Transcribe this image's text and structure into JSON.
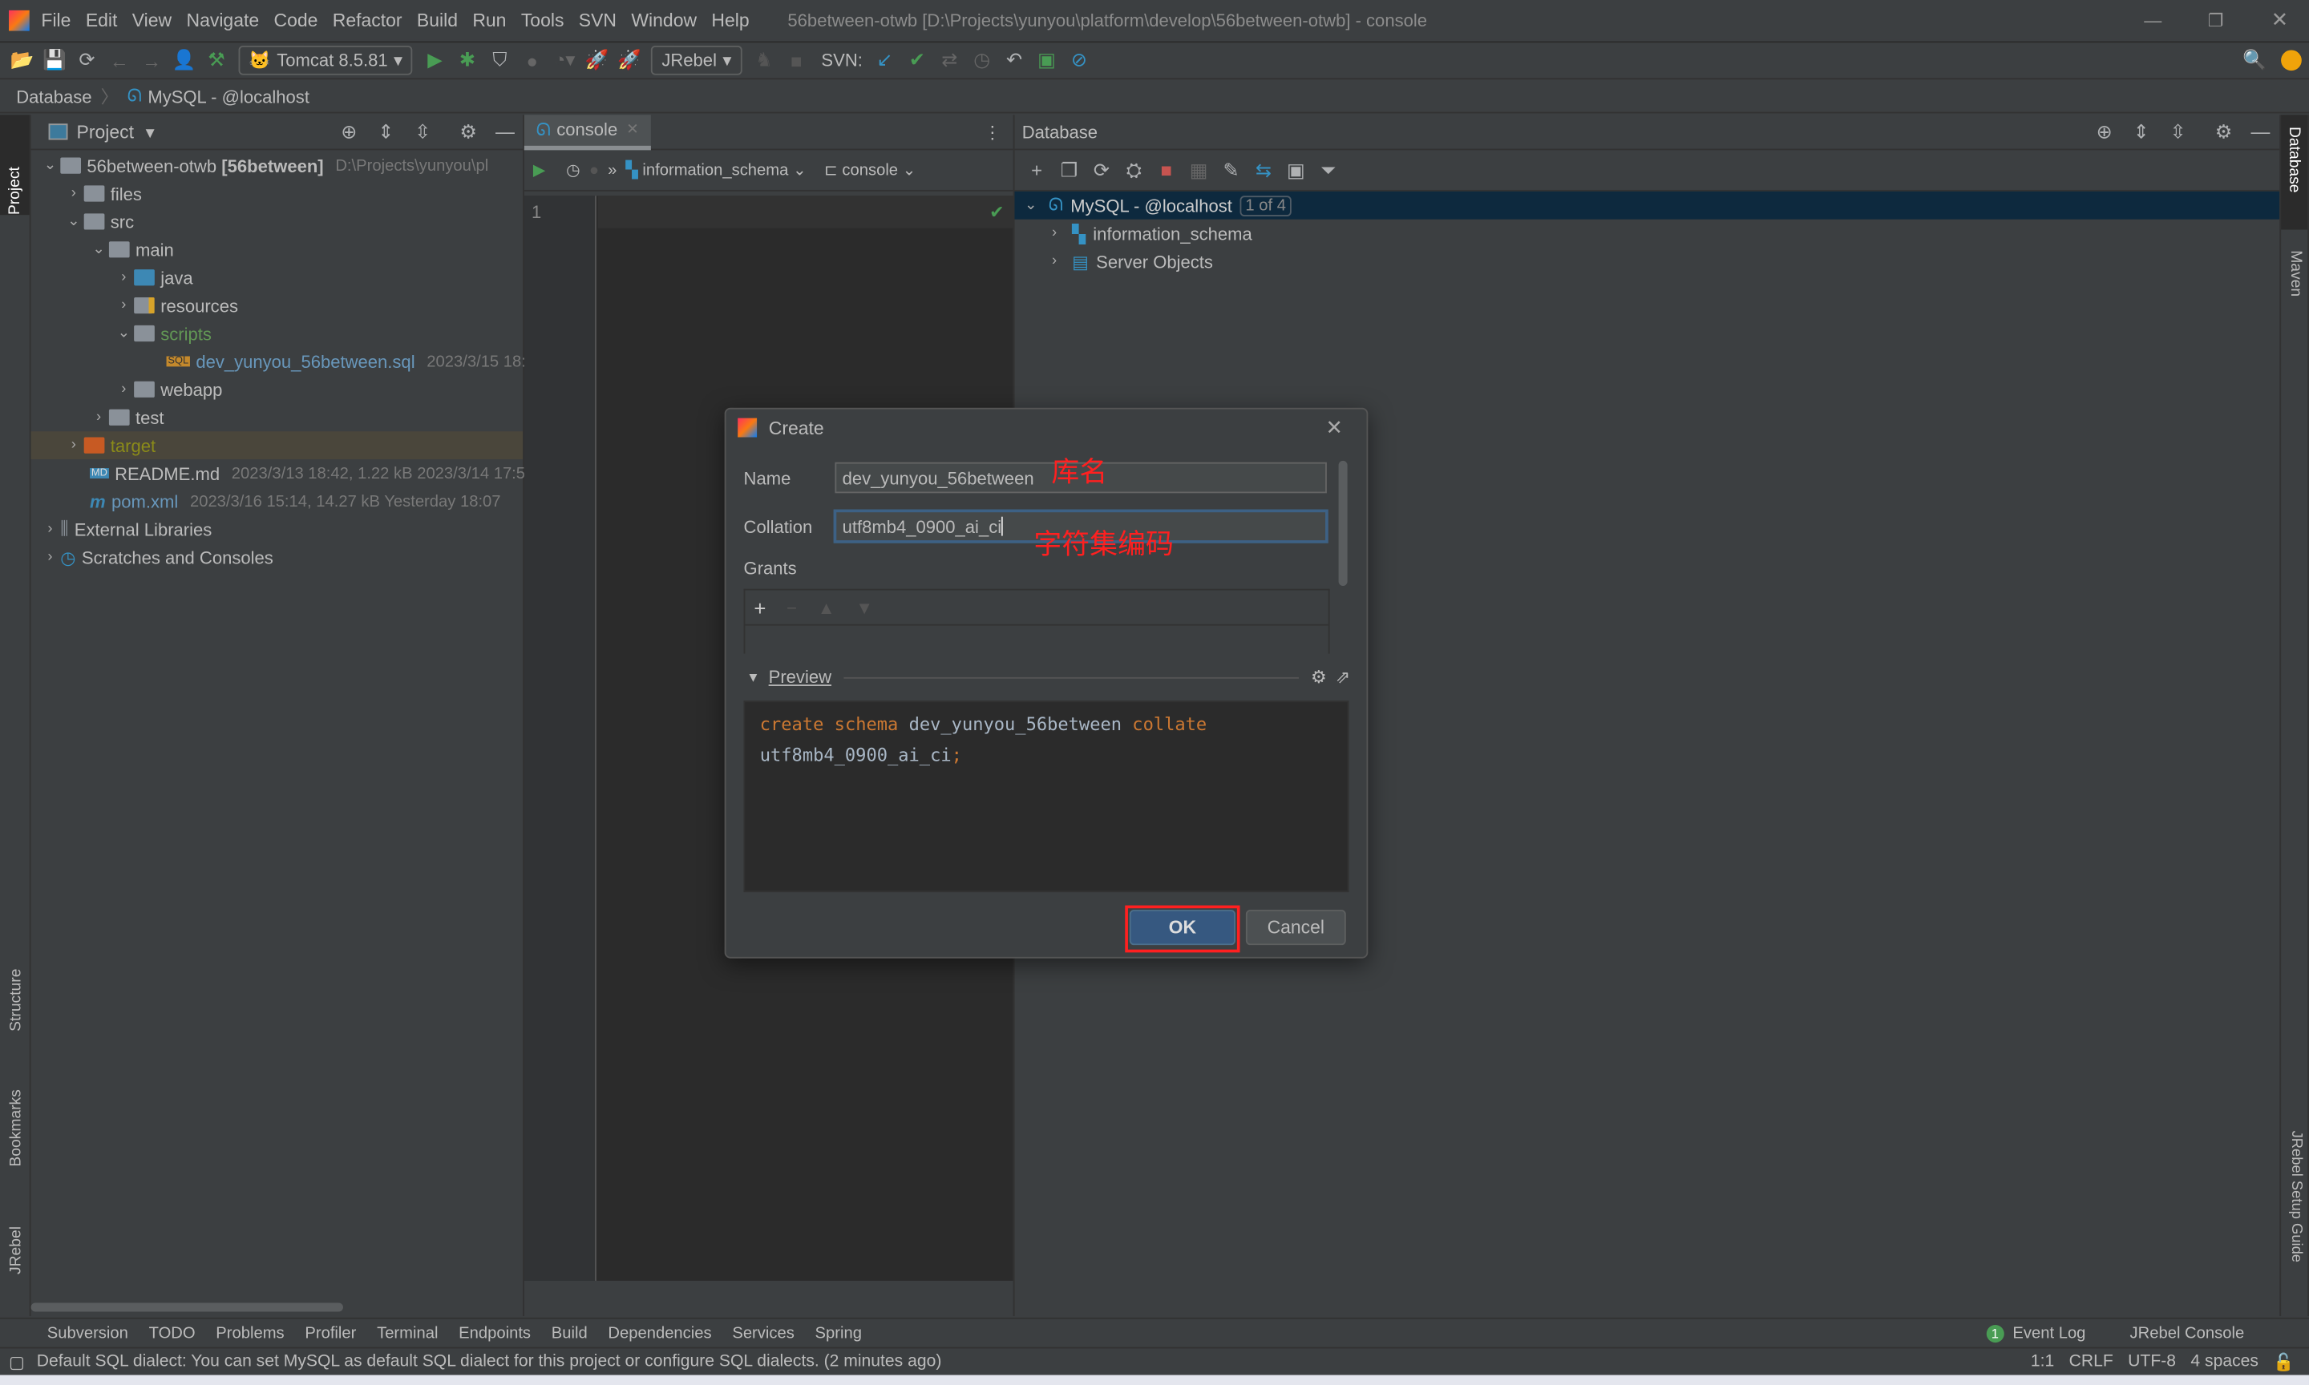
{
  "window": {
    "title": "56between-otwb [D:\\Projects\\yunyou\\platform\\develop\\56between-otwb] - console"
  },
  "menu": [
    "File",
    "Edit",
    "View",
    "Navigate",
    "Code",
    "Refactor",
    "Build",
    "Run",
    "Tools",
    "SVN",
    "Window",
    "Help"
  ],
  "toolbar": {
    "run_config": "Tomcat 8.5.81",
    "jrebel": "JRebel",
    "svn_label": "SVN:"
  },
  "breadcrumb": [
    "Database",
    "MySQL - @localhost"
  ],
  "left_stripe": [
    "Project",
    "Structure",
    "Bookmarks",
    "JRebel"
  ],
  "right_stripe": [
    "Database",
    "Maven",
    "JRebel Setup Guide"
  ],
  "project": {
    "title": "Project",
    "root": {
      "name": "56between-otwb",
      "module": "[56between]",
      "path": "D:\\Projects\\yunyou\\pl"
    },
    "items": [
      {
        "name": "files",
        "level": 1,
        "expanded": false
      },
      {
        "name": "src",
        "level": 1,
        "expanded": true
      },
      {
        "name": "main",
        "level": 2,
        "expanded": true
      },
      {
        "name": "java",
        "level": 3,
        "expanded": false
      },
      {
        "name": "resources",
        "level": 3,
        "expanded": false
      },
      {
        "name": "scripts",
        "level": 3,
        "expanded": true
      },
      {
        "name": "dev_yunyou_56between.sql",
        "level": 4,
        "meta": "2023/3/15 18:"
      },
      {
        "name": "webapp",
        "level": 3,
        "expanded": false
      },
      {
        "name": "test",
        "level": 2,
        "expanded": false
      },
      {
        "name": "target",
        "level": 1,
        "expanded": false
      },
      {
        "name": "README.md",
        "level": 1,
        "meta": "2023/3/13 18:42, 1.22 kB 2023/3/14 17:5"
      },
      {
        "name": "pom.xml",
        "level": 1,
        "meta": "2023/3/16 15:14, 14.27 kB Yesterday 18:07"
      }
    ],
    "extra": [
      "External Libraries",
      "Scratches and Consoles"
    ]
  },
  "editor": {
    "tab": "console",
    "schema": "information_schema",
    "session": "console",
    "line": "1"
  },
  "database": {
    "title": "Database",
    "connection": "MySQL - @localhost",
    "badge": "1 of 4",
    "children": [
      "information_schema",
      "Server Objects"
    ]
  },
  "dialog": {
    "title": "Create",
    "name_label": "Name",
    "name_value": "dev_yunyou_56between",
    "collation_label": "Collation",
    "collation_value": "utf8mb4_0900_ai_ci",
    "grants_label": "Grants",
    "preview_label": "Preview",
    "preview_line1": [
      "create",
      "schema",
      "dev_yunyou_56between",
      "collate"
    ],
    "preview_line2": "utf8mb4_0900_ai_ci",
    "ok": "OK",
    "cancel": "Cancel",
    "annotation_name": "库名",
    "annotation_collation": "字符集编码"
  },
  "bottom_tools": [
    "Subversion",
    "TODO",
    "Problems",
    "Profiler",
    "Terminal",
    "Endpoints",
    "Build",
    "Dependencies",
    "Services",
    "Spring"
  ],
  "bottom_right": {
    "event_log": "Event Log",
    "event_count": "1",
    "jrebel_console": "JRebel Console"
  },
  "status": {
    "message": "Default SQL dialect: You can set MySQL as default SQL dialect for this project or configure SQL dialects. (2 minutes ago)",
    "position": "1:1",
    "line_sep": "CRLF",
    "encoding": "UTF-8",
    "indent": "4 spaces"
  },
  "colors": {
    "accent": "#4a88c7",
    "keyword": "#cc7832",
    "selection": "#0d293e",
    "annotation": "#ff2020",
    "ok_button": "#365880"
  }
}
